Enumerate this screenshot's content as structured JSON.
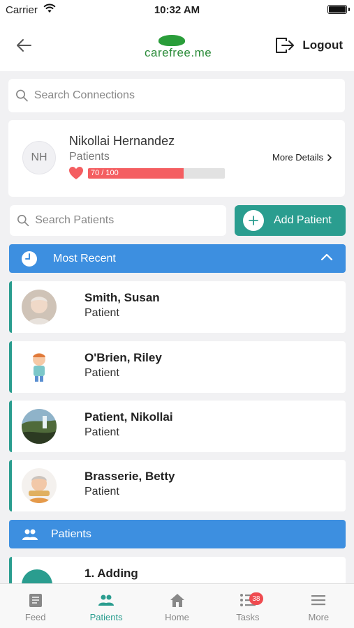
{
  "status_bar": {
    "carrier": "Carrier",
    "time": "10:32 AM"
  },
  "nav": {
    "logo_text": "carefree.me",
    "logout_label": "Logout"
  },
  "search_connections": {
    "placeholder": "Search Connections"
  },
  "profile": {
    "initials": "NH",
    "name": "Nikollai Hernandez",
    "role": "Patients",
    "progress_label": "70 / 100",
    "progress_fraction": 0.7,
    "more_details": "More Details"
  },
  "search_patients": {
    "placeholder": "Search Patients"
  },
  "add_patient_label": "Add Patient",
  "most_recent": {
    "label": "Most Recent"
  },
  "recent_patients": [
    {
      "name": "Smith, Susan",
      "type": "Patient"
    },
    {
      "name": "O'Brien, Riley",
      "type": "Patient"
    },
    {
      "name": "Patient, Nikollai",
      "type": "Patient"
    },
    {
      "name": "Brasserie, Betty",
      "type": "Patient"
    }
  ],
  "patients_section": {
    "label": "Patients"
  },
  "partial_item": {
    "name": "1. Adding"
  },
  "tabs": [
    {
      "label": "Feed",
      "icon": "feed-icon"
    },
    {
      "label": "Patients",
      "icon": "people-icon"
    },
    {
      "label": "Home",
      "icon": "home-icon"
    },
    {
      "label": "Tasks",
      "icon": "list-icon",
      "badge": "38"
    },
    {
      "label": "More",
      "icon": "menu-icon"
    }
  ],
  "colors": {
    "teal": "#2a9d8f",
    "blue": "#3d8fe0",
    "red": "#f45e61"
  }
}
